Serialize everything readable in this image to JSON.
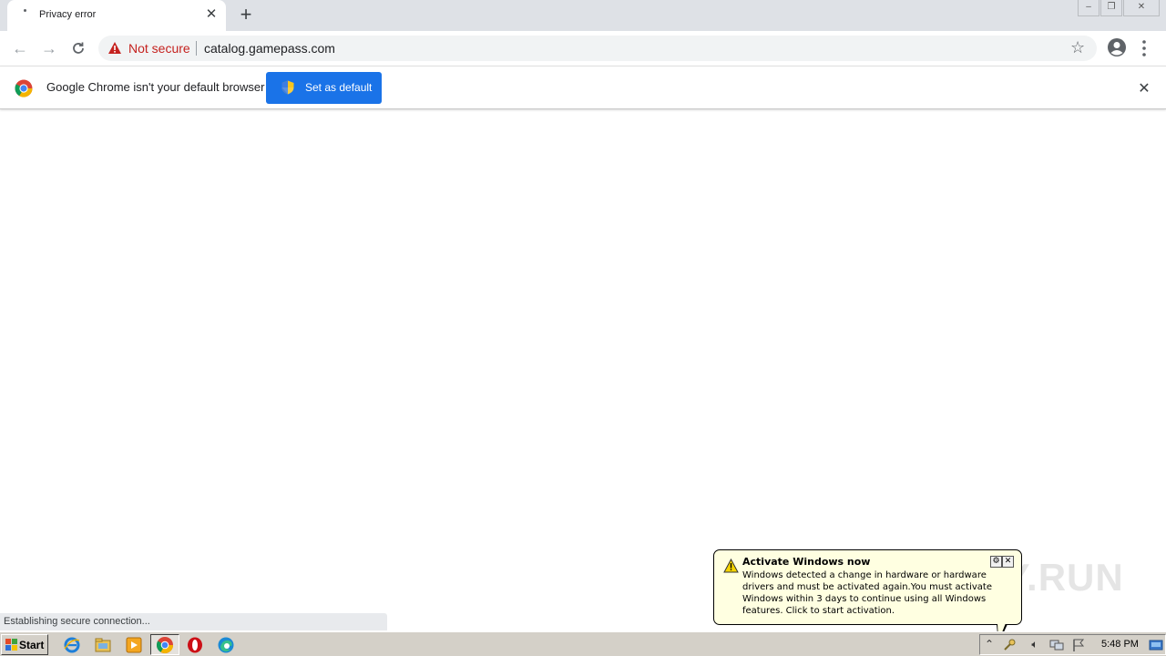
{
  "browser": {
    "tab": {
      "title": "Privacy error"
    },
    "window_controls": {
      "minimize": "–",
      "restore": "❐",
      "close": "✕"
    },
    "omnibox": {
      "security_label": "Not secure",
      "url": "catalog.gamepass.com"
    },
    "infobar": {
      "message": "Google Chrome isn't your default browser",
      "button_label": "Set as default"
    },
    "status": "Establishing secure connection..."
  },
  "balloon": {
    "title": "Activate Windows now",
    "message": "Windows detected a change in hardware or hardware drivers and must be activated again.You must activate Windows within 3 days to continue using all Windows features. Click to start activation.",
    "watermark": "ANY.RUN"
  },
  "taskbar": {
    "start_label": "Start",
    "pinned": [
      "internet-explorer-icon",
      "file-explorer-icon",
      "media-player-icon",
      "chrome-icon",
      "opera-icon",
      "edge-icon"
    ],
    "clock": "5:48 PM"
  },
  "colors": {
    "accent": "#1a73e8",
    "danger": "#c5221f",
    "balloon_bg": "#ffffe1",
    "taskbar": "#d4d0c8"
  }
}
